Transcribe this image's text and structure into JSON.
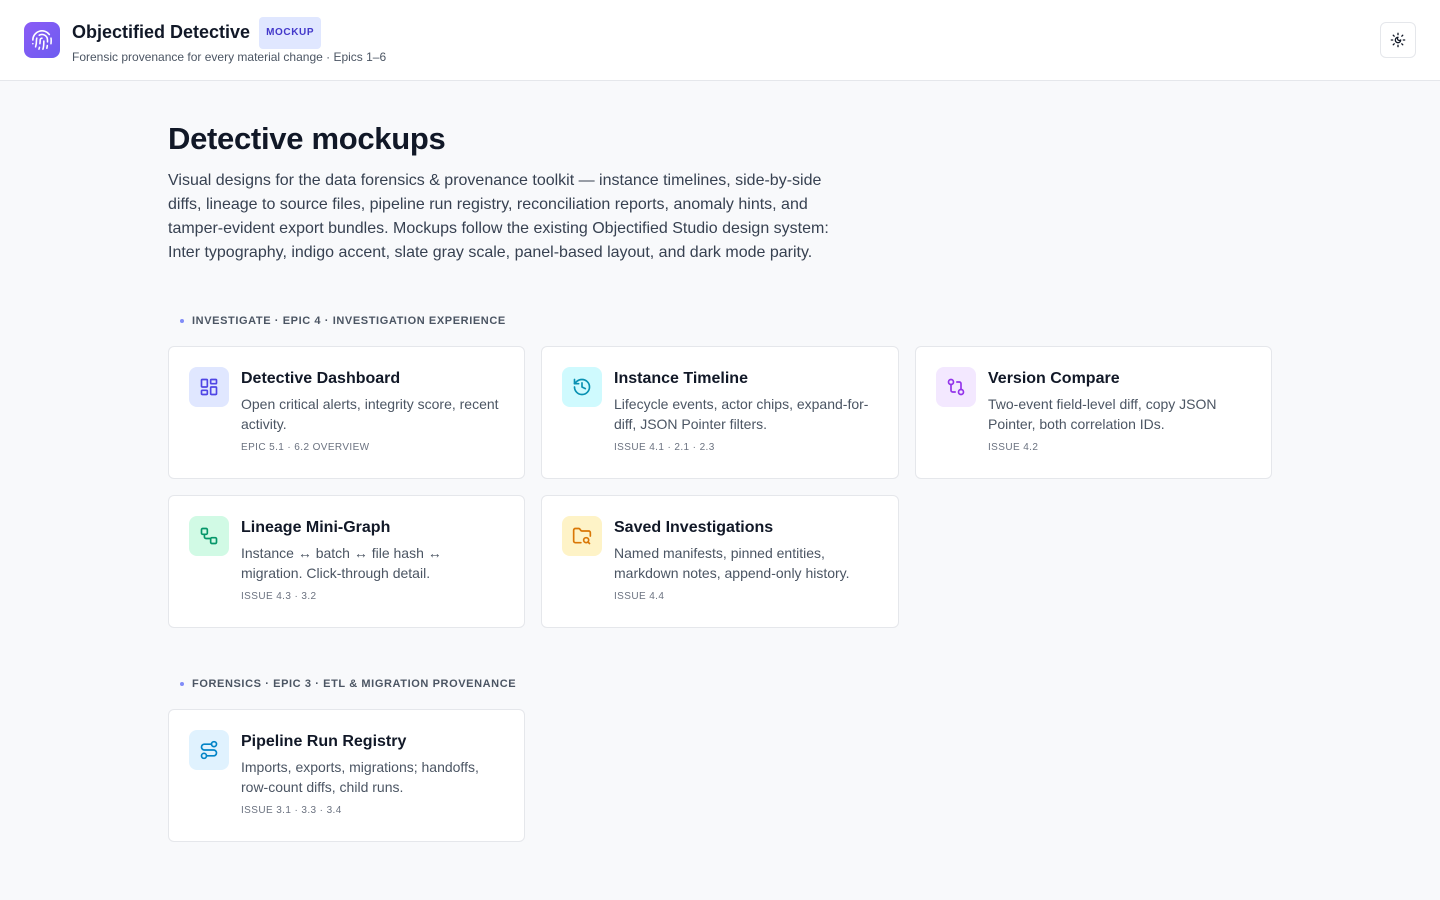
{
  "header": {
    "title": "Objectified Detective",
    "badge": "MOCKUP",
    "subtitle": "Forensic provenance for every material change · Epics 1–6",
    "logo_icon": "fingerprint-icon",
    "theme_toggle_icon": "theme-toggle-icon"
  },
  "page": {
    "title": "Detective mockups",
    "intro": "Visual designs for the data forensics & provenance toolkit — instance timelines, side-by-side diffs, lineage to source files, pipeline run registry, reconciliation reports, anomaly hints, and tamper-evident export bundles. Mockups follow the existing Objectified Studio design system: Inter typography, indigo accent, slate gray scale, panel-based layout, and dark mode parity."
  },
  "sections": [
    {
      "label": "INVESTIGATE · EPIC 4 · INVESTIGATION EXPERIENCE",
      "cards": [
        {
          "title": "Detective Dashboard",
          "desc": "Open critical alerts, integrity score, recent activity.",
          "meta": "EPIC 5.1 · 6.2 OVERVIEW",
          "icon": "dashboard-icon",
          "icon_bg": "#e0e7ff",
          "icon_color": "#4f46e5"
        },
        {
          "title": "Instance Timeline",
          "desc": "Lifecycle events, actor chips, expand-for-diff, JSON Pointer filters.",
          "meta": "ISSUE 4.1 · 2.1 · 2.3",
          "icon": "history-icon",
          "icon_bg": "#cffafe",
          "icon_color": "#0891b2"
        },
        {
          "title": "Version Compare",
          "desc": "Two-event field-level diff, copy JSON Pointer, both correlation IDs.",
          "meta": "ISSUE 4.2",
          "icon": "compare-icon",
          "icon_bg": "#f3e8ff",
          "icon_color": "#9333ea"
        },
        {
          "title": "Lineage Mini-Graph",
          "desc": "Instance ↔ batch ↔ file hash ↔ migration. Click-through detail.",
          "meta": "ISSUE 4.3 · 3.2",
          "icon": "lineage-icon",
          "icon_bg": "#d1fae5",
          "icon_color": "#059669"
        },
        {
          "title": "Saved Investigations",
          "desc": "Named manifests, pinned entities, markdown notes, append-only history.",
          "meta": "ISSUE 4.4",
          "icon": "folder-search-icon",
          "icon_bg": "#fef3c7",
          "icon_color": "#d97706"
        }
      ]
    },
    {
      "label": "FORENSICS · EPIC 3 · ETL & MIGRATION PROVENANCE",
      "cards": [
        {
          "title": "Pipeline Run Registry",
          "desc": "Imports, exports, migrations; handoffs, row-count diffs, child runs.",
          "meta": "ISSUE 3.1 · 3.3 · 3.4",
          "icon": "pipeline-icon",
          "icon_bg": "#e0f2fe",
          "icon_color": "#0284c7"
        }
      ]
    }
  ]
}
